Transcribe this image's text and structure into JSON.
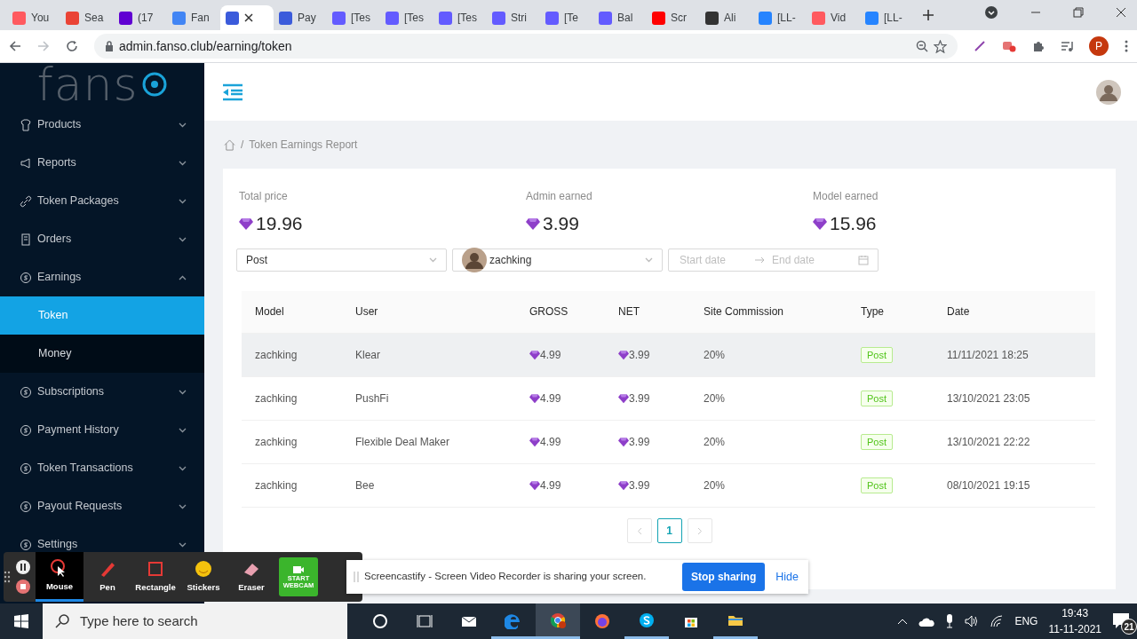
{
  "browser": {
    "tabs": [
      {
        "title": "You",
        "color": "#ff5a5f",
        "selected": false
      },
      {
        "title": "Sea",
        "color": "#ea4335",
        "selected": false
      },
      {
        "title": "(17",
        "color": "#6001d2",
        "selected": false
      },
      {
        "title": "Fan",
        "color": "#4285f4",
        "selected": false
      },
      {
        "color": "#3b5bdb",
        "selected": true
      },
      {
        "title": "Pay",
        "color": "#3b5bdb",
        "selected": false
      },
      {
        "title": "[Tes",
        "color": "#635bff",
        "selected": false
      },
      {
        "title": "[Tes",
        "color": "#635bff",
        "selected": false
      },
      {
        "title": "[Tes",
        "color": "#635bff",
        "selected": false
      },
      {
        "title": "Stri",
        "color": "#635bff",
        "selected": false
      },
      {
        "title": "[Te",
        "color": "#635bff",
        "selected": false
      },
      {
        "title": "Bal",
        "color": "#635bff",
        "selected": false
      },
      {
        "title": "Scr",
        "color": "#ff0000",
        "selected": false
      },
      {
        "title": "Ali",
        "color": "#333333",
        "selected": false
      },
      {
        "title": "[LL-",
        "color": "#2684ff",
        "selected": false
      },
      {
        "title": "Vid",
        "color": "#ff5a5f",
        "selected": false
      },
      {
        "title": "[LL-",
        "color": "#2684ff",
        "selected": false
      }
    ],
    "address": "admin.fanso.club/earning/token",
    "profile": "P"
  },
  "sidebar": {
    "logo": "fans",
    "items": [
      {
        "label": "Products",
        "expanded": false
      },
      {
        "label": "Reports",
        "expanded": false
      },
      {
        "label": "Token Packages",
        "expanded": false
      },
      {
        "label": "Orders",
        "expanded": false
      },
      {
        "label": "Earnings",
        "expanded": true,
        "children": [
          {
            "label": "Token",
            "selected": true
          },
          {
            "label": "Money",
            "selected": false
          }
        ]
      },
      {
        "label": "Subscriptions",
        "expanded": false
      },
      {
        "label": "Payment History",
        "expanded": false
      },
      {
        "label": "Token Transactions",
        "expanded": false
      },
      {
        "label": "Payout Requests",
        "expanded": false
      },
      {
        "label": "Settings",
        "expanded": false
      }
    ]
  },
  "breadcrumb": {
    "separator": "/",
    "items": [
      "Token Earnings Report"
    ]
  },
  "stats": [
    {
      "label": "Total price",
      "value": "19.96"
    },
    {
      "label": "Admin earned",
      "value": "3.99"
    },
    {
      "label": "Model earned",
      "value": "15.96"
    }
  ],
  "filters": {
    "type": "Post",
    "model": "zachking",
    "start_placeholder": "Start date",
    "end_placeholder": "End date"
  },
  "table": {
    "columns": [
      "Model",
      "User",
      "GROSS",
      "NET",
      "Site Commission",
      "Type",
      "Date"
    ],
    "rows": [
      {
        "hovered": true,
        "cells": [
          "zachking",
          "Klear",
          "4.99",
          "3.99",
          "20%",
          "Post",
          "11/11/2021 18:25"
        ]
      },
      {
        "hovered": false,
        "cells": [
          "zachking",
          "PushFi",
          "4.99",
          "3.99",
          "20%",
          "Post",
          "13/10/2021 23:05"
        ]
      },
      {
        "hovered": false,
        "cells": [
          "zachking",
          "Flexible Deal Maker",
          "4.99",
          "3.99",
          "20%",
          "Post",
          "13/10/2021 22:22"
        ]
      },
      {
        "hovered": false,
        "cells": [
          "zachking",
          "Bee",
          "4.99",
          "3.99",
          "20%",
          "Post",
          "08/10/2021 19:15"
        ]
      }
    ]
  },
  "pagination": {
    "pages": [
      {
        "label": "1",
        "selected": true
      }
    ]
  },
  "recorder": {
    "tools": [
      {
        "label": "Mouse",
        "selected": true
      },
      {
        "label": "Pen",
        "selected": false
      },
      {
        "label": "Rectangle",
        "selected": false
      },
      {
        "label": "Stickers",
        "selected": false
      },
      {
        "label": "Eraser",
        "selected": false
      }
    ],
    "webcam": "START WEBCAM"
  },
  "share_bar": {
    "message": "Screencastify - Screen Video Recorder is sharing your screen.",
    "stop": "Stop sharing",
    "hide": "Hide"
  },
  "taskbar": {
    "search_placeholder": "Type here to search",
    "apps": [
      {
        "kind": "cortana",
        "running": false,
        "selected": false
      },
      {
        "kind": "taskview",
        "running": false,
        "selected": false
      },
      {
        "kind": "mail",
        "running": false,
        "selected": false
      },
      {
        "kind": "edge",
        "running": true,
        "selected": false
      },
      {
        "kind": "chrome",
        "running": true,
        "selected": true
      },
      {
        "kind": "firefox",
        "running": false,
        "selected": false
      },
      {
        "kind": "skype",
        "running": true,
        "selected": false
      },
      {
        "kind": "store",
        "running": false,
        "selected": false
      },
      {
        "kind": "explorer",
        "running": true,
        "selected": false
      }
    ],
    "language": "ENG",
    "time": "19:43",
    "date": "11-11-2021",
    "notifications": "21"
  }
}
